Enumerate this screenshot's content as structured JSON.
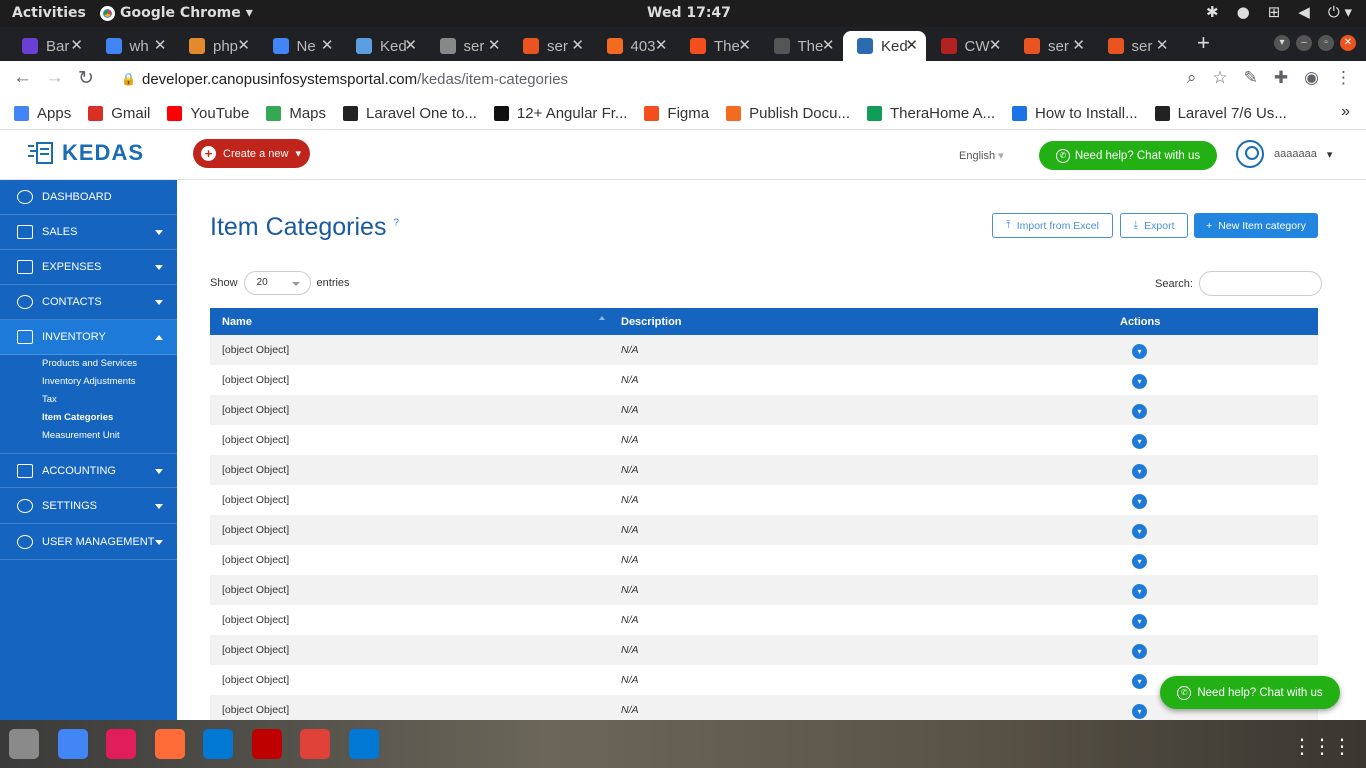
{
  "system": {
    "activities": "Activities",
    "app_name": "Google Chrome",
    "clock": "Wed 17:47"
  },
  "tabs": [
    {
      "label": "Bar",
      "color": "#6a3fd4"
    },
    {
      "label": "wh",
      "color": "#4285f4"
    },
    {
      "label": "php",
      "color": "#e48a2e"
    },
    {
      "label": "Ne",
      "color": "#4285f4"
    },
    {
      "label": "Ked",
      "color": "#5aa0e0"
    },
    {
      "label": "ser",
      "color": "#888888"
    },
    {
      "label": "ser",
      "color": "#e95420"
    },
    {
      "label": "403",
      "color": "#f26b21"
    },
    {
      "label": "The",
      "color": "#f24e1e"
    },
    {
      "label": "The",
      "color": "#555555"
    },
    {
      "label": "Ked",
      "color": "#2b6cb0",
      "active": true
    },
    {
      "label": "CW",
      "color": "#b22222"
    },
    {
      "label": "ser",
      "color": "#e95420"
    },
    {
      "label": "ser",
      "color": "#e95420"
    }
  ],
  "address": {
    "domain": "developer.canopusinfosystemsportal.com",
    "path": "/kedas/item-categories"
  },
  "bookmarks": [
    {
      "label": "Apps",
      "color": "#4285f4"
    },
    {
      "label": "Gmail",
      "color": "#d93025"
    },
    {
      "label": "YouTube",
      "color": "#ff0000"
    },
    {
      "label": "Maps",
      "color": "#34a853"
    },
    {
      "label": "Laravel One to...",
      "color": "#222222"
    },
    {
      "label": "12+ Angular Fr...",
      "color": "#111111"
    },
    {
      "label": "Figma",
      "color": "#f24e1e"
    },
    {
      "label": "Publish Docu...",
      "color": "#f26b21"
    },
    {
      "label": "TheraHome A...",
      "color": "#0f9d58"
    },
    {
      "label": "How to Install...",
      "color": "#1a73e8"
    },
    {
      "label": "Laravel 7/6 Us...",
      "color": "#222222"
    }
  ],
  "header": {
    "logo": "KEDAS",
    "create_label": "Create a new",
    "language": "English",
    "help_label": "Need help? Chat with us",
    "username": "aaaaaaa"
  },
  "sidebar": {
    "items": [
      {
        "label": "DASHBOARD"
      },
      {
        "label": "SALES"
      },
      {
        "label": "EXPENSES"
      },
      {
        "label": "CONTACTS"
      },
      {
        "label": "INVENTORY"
      },
      {
        "label": "ACCOUNTING"
      },
      {
        "label": "SETTINGS"
      },
      {
        "label": "USER MANAGEMENT"
      }
    ],
    "inventory_sub": [
      "Products and Services",
      "Inventory Adjustments",
      "Tax",
      "Item Categories",
      "Measurement Unit"
    ]
  },
  "page": {
    "title": "Item Categories",
    "help_mark": "?",
    "import_label": "Import from Excel",
    "export_label": "Export",
    "new_label": "New Item category",
    "show_label": "Show",
    "entries_value": "20",
    "entries_label": "entries",
    "search_label": "Search:"
  },
  "table": {
    "headers": [
      "Name",
      "Description",
      "Actions"
    ],
    "rows": [
      {
        "name": "[object Object]",
        "desc": "N/A"
      },
      {
        "name": "[object Object]",
        "desc": "N/A"
      },
      {
        "name": "[object Object]",
        "desc": "N/A"
      },
      {
        "name": "[object Object]",
        "desc": "N/A"
      },
      {
        "name": "[object Object]",
        "desc": "N/A"
      },
      {
        "name": "[object Object]",
        "desc": "N/A"
      },
      {
        "name": "[object Object]",
        "desc": "N/A"
      },
      {
        "name": "[object Object]",
        "desc": "N/A"
      },
      {
        "name": "[object Object]",
        "desc": "N/A"
      },
      {
        "name": "[object Object]",
        "desc": "N/A"
      },
      {
        "name": "[object Object]",
        "desc": "N/A"
      },
      {
        "name": "[object Object]",
        "desc": "N/A"
      },
      {
        "name": "[object Object]",
        "desc": "N/A"
      }
    ]
  },
  "float_help": "Need help? Chat with us",
  "dock": [
    {
      "name": "files-icon",
      "color": "#8a8a8a"
    },
    {
      "name": "chrome-icon",
      "color": "#4285f4"
    },
    {
      "name": "slack-icon",
      "color": "#e01e5a"
    },
    {
      "name": "postman-icon",
      "color": "#ff6c37"
    },
    {
      "name": "vscode-icon",
      "color": "#0078d4"
    },
    {
      "name": "filezilla-icon",
      "color": "#bf0000"
    },
    {
      "name": "git-icon",
      "color": "#e0423a"
    },
    {
      "name": "vscode-icon",
      "color": "#0078d4"
    }
  ]
}
